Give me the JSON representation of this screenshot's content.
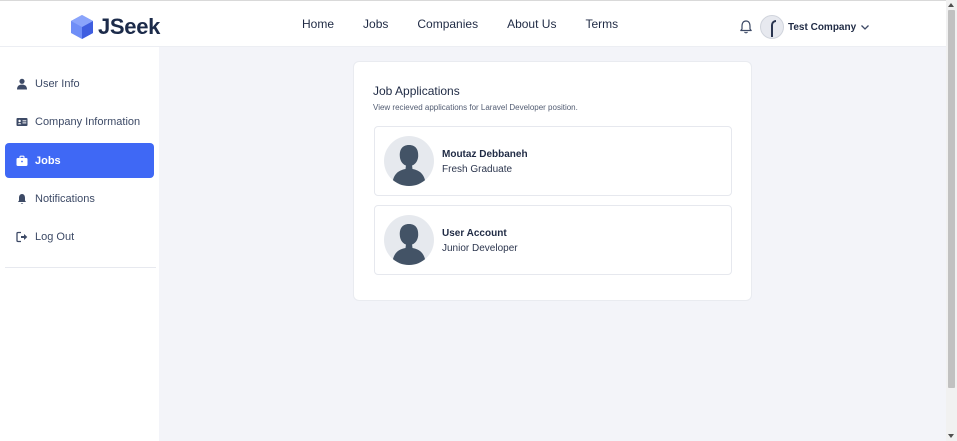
{
  "brand": {
    "name": "JSeek"
  },
  "nav": {
    "items": [
      {
        "label": "Home"
      },
      {
        "label": "Jobs"
      },
      {
        "label": "Companies"
      },
      {
        "label": "About Us"
      },
      {
        "label": "Terms"
      }
    ]
  },
  "user": {
    "name": "Test Company"
  },
  "sidebar": {
    "items": [
      {
        "label": "User Info",
        "icon": "user-icon"
      },
      {
        "label": "Company Information",
        "icon": "id-card-icon"
      },
      {
        "label": "Jobs",
        "icon": "briefcase-icon",
        "active": true
      },
      {
        "label": "Notifications",
        "icon": "bell-icon"
      },
      {
        "label": "Log Out",
        "icon": "logout-icon"
      }
    ]
  },
  "main": {
    "title": "Job Applications",
    "subtitle": "View recieved applications for Laravel Developer position.",
    "applications": [
      {
        "name": "Moutaz Debbaneh",
        "role": "Fresh Graduate"
      },
      {
        "name": "User Account",
        "role": "Junior Developer"
      }
    ]
  },
  "colors": {
    "accent": "#3f68f5",
    "text": "#1f2a44",
    "background": "#f3f4f9"
  }
}
